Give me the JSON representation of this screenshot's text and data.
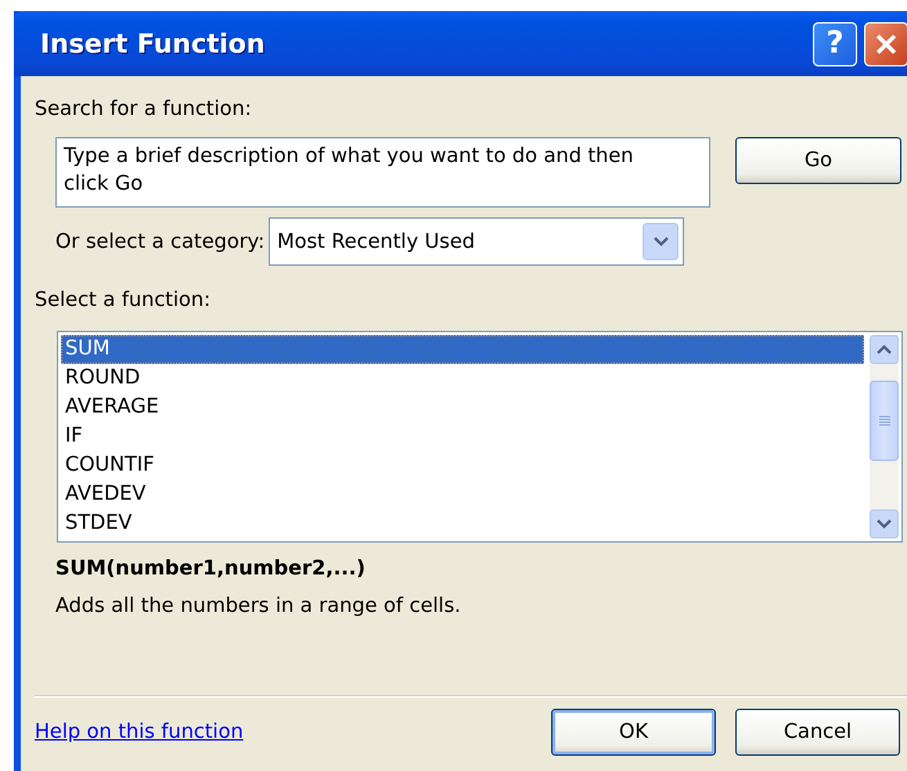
{
  "window": {
    "title": "Insert Function",
    "help_button": "?"
  },
  "search": {
    "label": "Search for a function:",
    "value": "Type a brief description of what you want to do and then click Go",
    "button": "Go"
  },
  "category": {
    "label": "Or select a category:",
    "value": "Most Recently Used"
  },
  "functions": {
    "label": "Select a function:",
    "items": [
      {
        "name": "SUM",
        "selected": true
      },
      {
        "name": "ROUND",
        "selected": false
      },
      {
        "name": "AVERAGE",
        "selected": false
      },
      {
        "name": "IF",
        "selected": false
      },
      {
        "name": "COUNTIF",
        "selected": false
      },
      {
        "name": "AVEDEV",
        "selected": false
      },
      {
        "name": "STDEV",
        "selected": false
      }
    ]
  },
  "signature": "SUM(number1,number2,...)",
  "description": "Adds all the numbers in a range of cells.",
  "help_link": "Help on this function",
  "buttons": [
    {
      "label": "OK",
      "default": true
    },
    {
      "label": "Cancel",
      "default": false
    }
  ]
}
